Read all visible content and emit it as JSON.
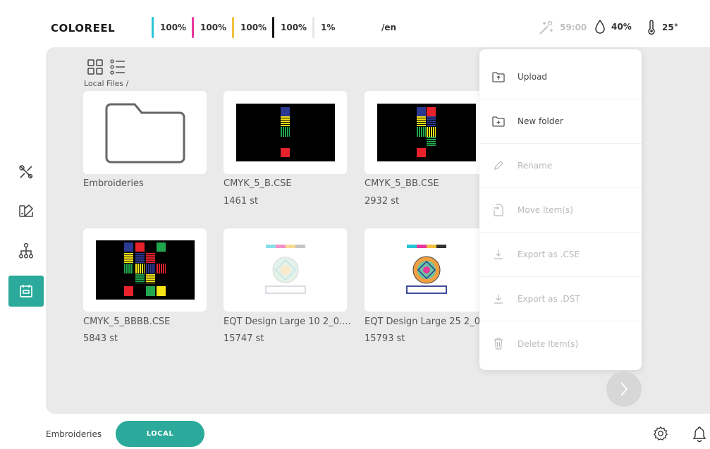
{
  "header": {
    "brand": "COLOREEL",
    "inks": [
      {
        "color": "#29c4d6",
        "value": "100%"
      },
      {
        "color": "#e6389e",
        "value": "100%"
      },
      {
        "color": "#f2c040",
        "value": "100%"
      },
      {
        "color": "#111111",
        "value": "100%"
      },
      {
        "color": "#e6e6e6",
        "value": "1%"
      }
    ],
    "language": "/en",
    "timer": "59:00",
    "humidity": "40%",
    "temperature": "25°"
  },
  "sidebar": {
    "items": [
      {
        "icon": "tools-icon"
      },
      {
        "icon": "palette-icon"
      },
      {
        "icon": "network-icon"
      },
      {
        "icon": "embroidery-icon",
        "active": true
      }
    ]
  },
  "browser": {
    "breadcrumb": "Local Files /",
    "files": [
      {
        "name": "Embroideries",
        "info": "",
        "kind": "folder"
      },
      {
        "name": "CMYK_5_B.CSE",
        "info": "1461 st",
        "kind": "cmyk"
      },
      {
        "name": "CMYK_5_BB.CSE",
        "info": "2932 st",
        "kind": "cmyk"
      },
      {
        "name": "CMYK_5_BBBB.CSE",
        "info": "5843 st",
        "kind": "cmyk"
      },
      {
        "name": "EQT Design Large 10 2_0....",
        "info": "15747 st",
        "kind": "eqt"
      },
      {
        "name": "EQT Design Large 25 2_0...",
        "info": "15793 st",
        "kind": "eqt"
      }
    ]
  },
  "menu": {
    "items": [
      {
        "label": "Upload",
        "enabled": true
      },
      {
        "label": "New folder",
        "enabled": true
      },
      {
        "label": "Rename",
        "enabled": false
      },
      {
        "label": "Move Item(s)",
        "enabled": false
      },
      {
        "label": "Export as .CSE",
        "enabled": false
      },
      {
        "label": "Export as .DST",
        "enabled": false
      },
      {
        "label": "Delete Item(s)",
        "enabled": false
      }
    ]
  },
  "footer": {
    "section_label": "Embroideries",
    "local_button": "LOCAL"
  },
  "colors": {
    "accent": "#2ba99a",
    "panel_bg": "#eaeaea"
  }
}
